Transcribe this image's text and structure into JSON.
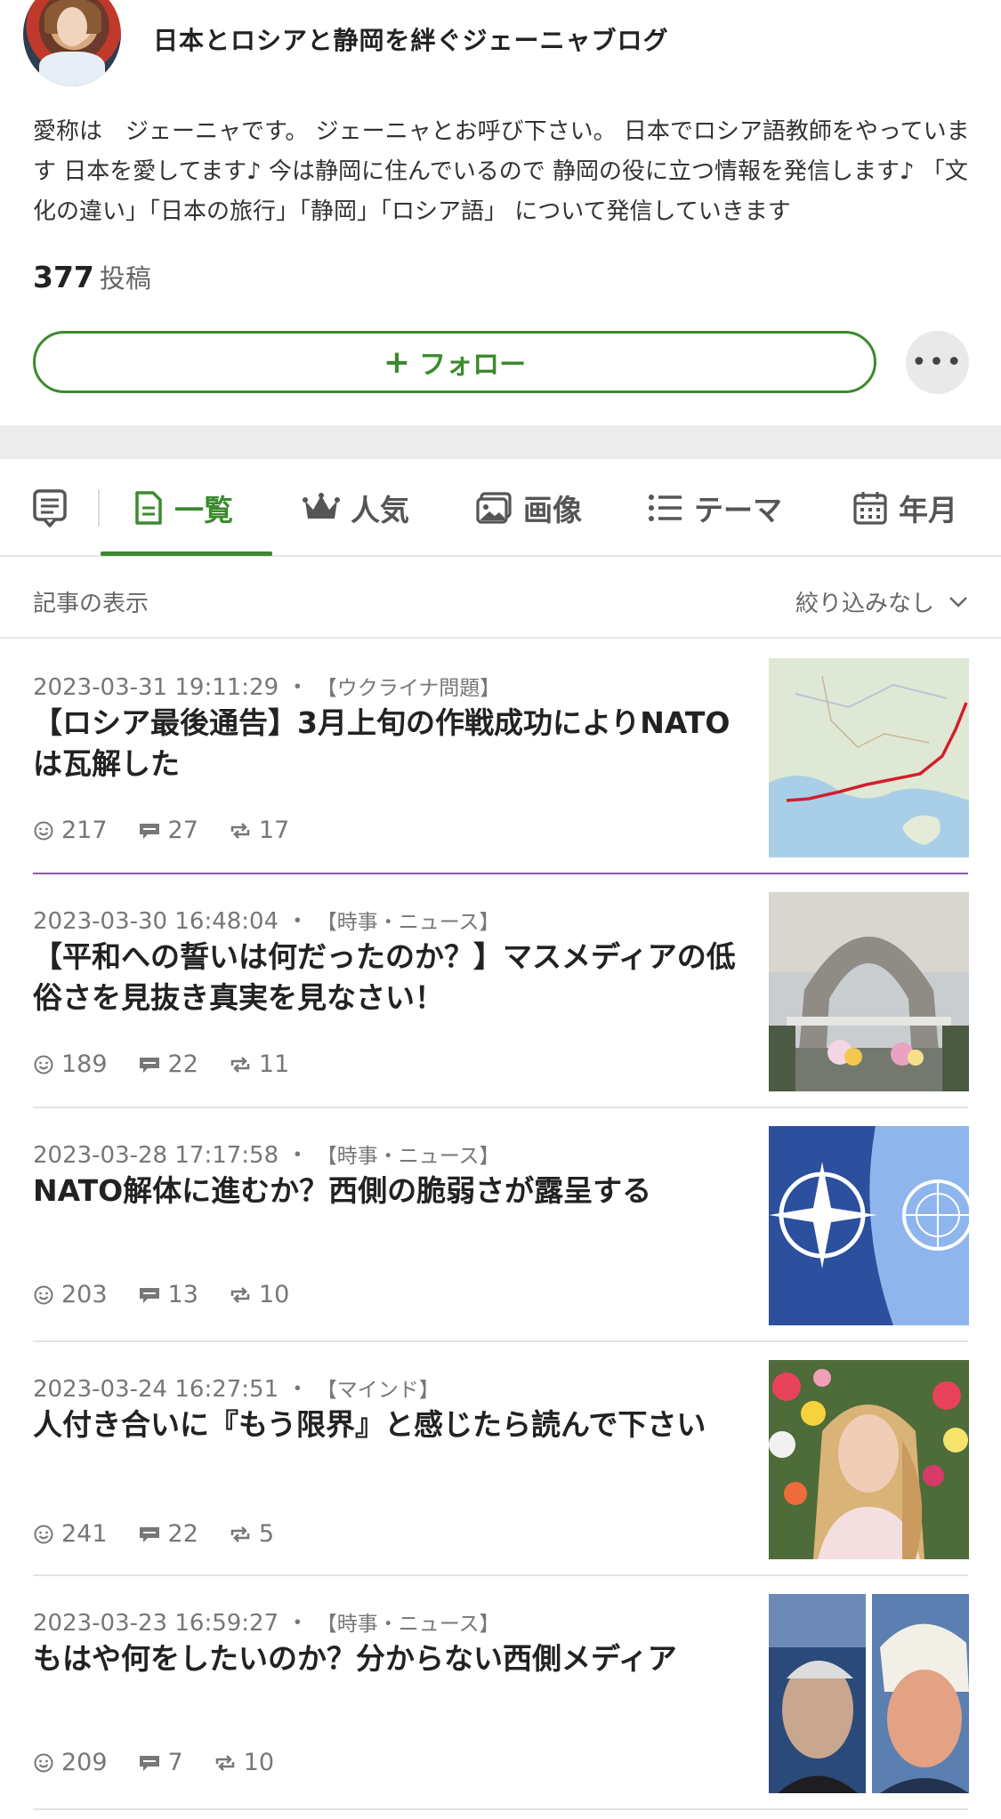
{
  "profile": {
    "blog_title": "日本とロシアと静岡を絆ぐジェーニャブログ",
    "description": "愛称は　ジェーニャです。 ジェーニャとお呼び下さい。 日本でロシア語教師をやっています 日本を愛してます♪ 今は静岡に住んでいるので 静岡の役に立つ情報を発信します♪ 「文化の違い」「日本の旅行」「静岡」「ロシア語」 について発信していきます",
    "post_count": "377",
    "post_unit": "投稿",
    "follow_label": "フォロー",
    "follow_plus": "+",
    "more_label": "•••"
  },
  "tabs": [
    {
      "label": "",
      "icon": "article-list-icon"
    },
    {
      "label": "一覧",
      "icon": "document-icon",
      "active": true
    },
    {
      "label": "人気",
      "icon": "crown-icon"
    },
    {
      "label": "画像",
      "icon": "image-icon"
    },
    {
      "label": "テーマ",
      "icon": "list-icon"
    },
    {
      "label": "年月",
      "icon": "calendar-icon"
    }
  ],
  "filter": {
    "label": "記事の表示",
    "selected": "絞り込みなし"
  },
  "articles": [
    {
      "date": "2023-03-31 19:11:29",
      "theme": "【ウクライナ問題】",
      "title": "【ロシア最後通告】3月上旬の作戦成功によりNATOは瓦解した",
      "likes": "217",
      "comments": "27",
      "reblogs": "17",
      "thumb": "map-image"
    },
    {
      "date": "2023-03-30 16:48:04",
      "theme": "【時事・ニュース】",
      "title": "【平和への誓いは何だったのか？】マスメディアの低俗さを見抜き真実を見なさい！",
      "likes": "189",
      "comments": "22",
      "reblogs": "11",
      "thumb": "memorial-image"
    },
    {
      "date": "2023-03-28 17:17:58",
      "theme": "【時事・ニュース】",
      "title": "NATO解体に進むか？西側の脆弱さが露呈する",
      "likes": "203",
      "comments": "13",
      "reblogs": "10",
      "thumb": "flags-image"
    },
    {
      "date": "2023-03-24 16:27:51",
      "theme": "【マインド】",
      "title": "人付き合いに『もう限界』と感じたら読んで下さい",
      "likes": "241",
      "comments": "22",
      "reblogs": "5",
      "thumb": "portrait-image"
    },
    {
      "date": "2023-03-23 16:59:27",
      "theme": "【時事・ニュース】",
      "title": "もはや何をしたいのか？分からない西側メディア",
      "likes": "209",
      "comments": "7",
      "reblogs": "10",
      "thumb": "two-men-image"
    }
  ],
  "colors": {
    "accent": "#3c8a2e",
    "separator_highlight": "#8e5aa8"
  },
  "meta_separator": "・"
}
